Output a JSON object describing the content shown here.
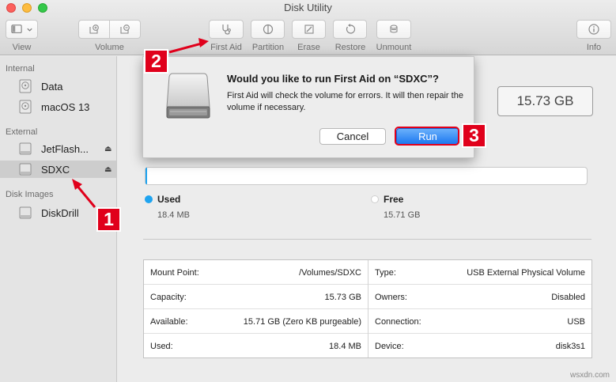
{
  "window": {
    "title": "Disk Utility"
  },
  "toolbar": {
    "view_label": "View",
    "volume_label": "Volume",
    "first_aid_label": "First Aid",
    "partition_label": "Partition",
    "erase_label": "Erase",
    "restore_label": "Restore",
    "unmount_label": "Unmount",
    "info_label": "Info"
  },
  "sidebar": {
    "internal_header": "Internal",
    "external_header": "External",
    "disk_images_header": "Disk Images",
    "items": [
      {
        "label": "Data"
      },
      {
        "label": "macOS 13"
      },
      {
        "label": "JetFlash..."
      },
      {
        "label": "SDXC"
      },
      {
        "label": "DiskDrill"
      }
    ]
  },
  "volume": {
    "capacity_display": "15.73 GB",
    "used_label": "Used",
    "used_value": "18.4 MB",
    "free_label": "Free",
    "free_value": "15.71 GB",
    "used_fraction": 0.0012,
    "used_color": "#1fa4f0"
  },
  "info": {
    "left": [
      {
        "key": "Mount Point:",
        "value": "/Volumes/SDXC"
      },
      {
        "key": "Capacity:",
        "value": "15.73 GB"
      },
      {
        "key": "Available:",
        "value": "15.71 GB (Zero KB purgeable)"
      },
      {
        "key": "Used:",
        "value": "18.4 MB"
      }
    ],
    "right": [
      {
        "key": "Type:",
        "value": "USB External Physical Volume"
      },
      {
        "key": "Owners:",
        "value": "Disabled"
      },
      {
        "key": "Connection:",
        "value": "USB"
      },
      {
        "key": "Device:",
        "value": "disk3s1"
      }
    ]
  },
  "dialog": {
    "title": "Would you like to run First Aid on “SDXC”?",
    "message": "First Aid will check the volume for errors. It will then repair the volume if necessary.",
    "cancel_label": "Cancel",
    "run_label": "Run"
  },
  "annotations": {
    "badge_1": "1",
    "badge_2": "2",
    "badge_3": "3",
    "color": "#e0001b"
  },
  "watermark": "wsxdn.com"
}
